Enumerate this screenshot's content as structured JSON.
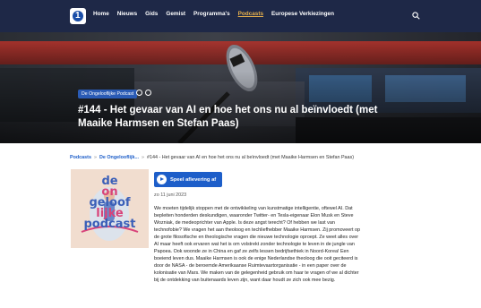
{
  "nav": {
    "items": [
      "Home",
      "Nieuws",
      "Gids",
      "Gemist",
      "Programma's",
      "Podcasts",
      "Europese Verkiezingen"
    ],
    "active": "Podcasts"
  },
  "hero": {
    "badge": "De Ongelooflijke Podcast",
    "title": "#144 - Het gevaar van AI en hoe het ons nu al beïnvloedt (met Maaike Harmsen en Stefan Paas)"
  },
  "breadcrumb": {
    "items": [
      "Podcasts",
      "De Ongelooflijk...",
      "#144 - Het gevaar van AI en hoe het ons nu al beïnvloedt (met Maaike Harmsen en Stefan Paas)"
    ],
    "separator": "»"
  },
  "cover": {
    "line1": "de",
    "line2": "on",
    "line3": "geloof",
    "line4": "lijke",
    "line5": "podcast"
  },
  "episode": {
    "play_label": "Speel aflevering af",
    "date": "zo 11 juni 2023",
    "description": "We moeten tijdelijk stoppen met de ontwikkeling van kunstmatige intelligentie, oftewel AI. Dat bepleiten honderden deskundigen, waaronder Twitter- en Tesla-eigenaar Elon Musk en Steve Wozniak, de medeoprichter van Apple. Is deze angst terecht? Of hebben we last van technofobie? We vragen het aan theoloog en techliefhebber Maaike Harmsen. Zij promoveert op de grote filosofische en theologische vragen die nieuwe technologie oproept. Ze weet alles over AI maar heeft ook ervaren wat het is om volstrekt zonder technologie te leven in de jungle van Papoea. Ook woonde ze in China en gaf ze zelfs lessen bedrijfsethiek in Noord-Korea! Een boeiend leven dus. Maaike Harmsen is ook de enige Nederlandse theoloog die ooit geciteerd is door de NASA - de beroemde Amerikaanse Ruimtevaartorganisatie - in een paper over de kolonisatie van Mars. We maken van de gelegenheid gebruik om haar te vragen of we al dichter bij de ontdekking van buitenaards leven zijn, want daar houdt ze zich ook mee bezig."
  },
  "colors": {
    "nav_bg": "#1e2847",
    "accent_blue": "#1d5ec9",
    "active_nav": "#e8b14c",
    "cover_bg": "#f1ddcf",
    "cover_pink": "#d8437a",
    "cover_blue": "#3a5fb8"
  },
  "icons": [
    "npo-logo-icon",
    "search-icon",
    "share-icon",
    "podcast-icon",
    "play-icon"
  ]
}
